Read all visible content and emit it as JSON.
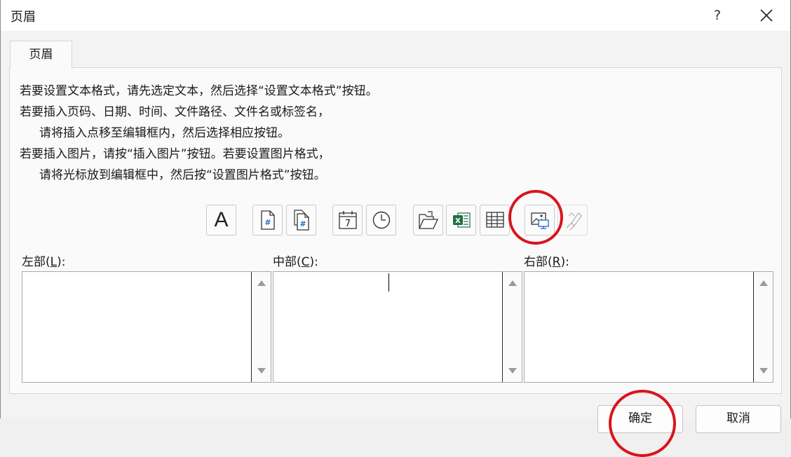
{
  "window": {
    "title": "页眉",
    "help_label": "?",
    "close_icon": "close-icon"
  },
  "tab": {
    "label": "页眉"
  },
  "instructions": [
    "若要设置文本格式，请先选定文本，然后选择“设置文本格式”按钮。",
    "若要插入页码、日期、时间、文件路径、文件名或标签名，",
    "请将插入点移至编辑框内，然后选择相应按钮。",
    "若要插入图片，请按“插入图片”按钮。若要设置图片格式，",
    "请将光标放到编辑框中，然后按“设置图片格式”按钮。"
  ],
  "toolbar": [
    {
      "name": "format-text-icon",
      "glyph": "A"
    },
    {
      "name": "insert-page-number-icon"
    },
    {
      "name": "insert-page-count-icon"
    },
    {
      "name": "insert-date-icon",
      "glyph": "7"
    },
    {
      "name": "insert-time-icon"
    },
    {
      "name": "insert-file-path-icon"
    },
    {
      "name": "insert-file-name-icon"
    },
    {
      "name": "insert-sheet-name-icon"
    },
    {
      "name": "insert-picture-icon"
    },
    {
      "name": "format-picture-icon",
      "state": "disabled"
    }
  ],
  "sections": {
    "left": {
      "label_pre": "左部(",
      "mnemonic": "L",
      "label_post": "):"
    },
    "center": {
      "label_pre": "中部(",
      "mnemonic": "C",
      "label_post": "):"
    },
    "right": {
      "label_pre": "右部(",
      "mnemonic": "R",
      "label_post": "):"
    }
  },
  "footer": {
    "ok_label": "确定",
    "cancel_label": "取消"
  },
  "colors": {
    "annotation_circle": "#d9151d",
    "excel_green": "#1e7145",
    "field_blue": "#2a72c8"
  }
}
